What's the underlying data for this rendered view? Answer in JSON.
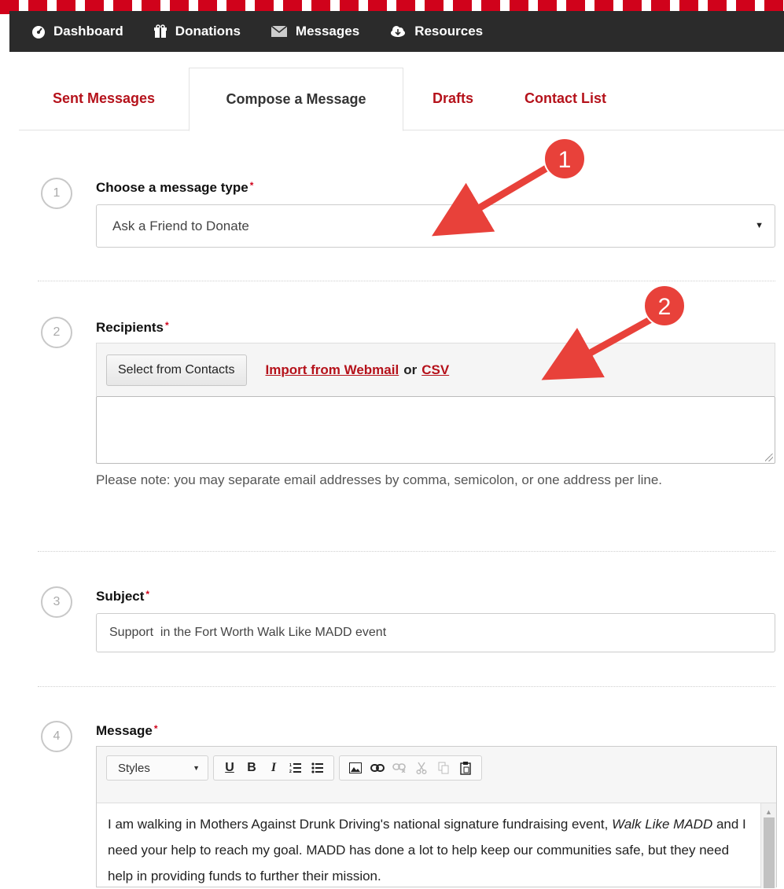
{
  "nav": {
    "items": [
      {
        "label": "Dashboard",
        "icon": "dashboard-icon"
      },
      {
        "label": "Donations",
        "icon": "gift-icon"
      },
      {
        "label": "Messages",
        "icon": "envelope-icon"
      },
      {
        "label": "Resources",
        "icon": "cloud-download-icon"
      }
    ]
  },
  "tabs": {
    "sent": "Sent Messages",
    "compose": "Compose a Message",
    "drafts": "Drafts",
    "contacts": "Contact List",
    "active": "Compose a Message"
  },
  "steps": {
    "type": {
      "number": "1",
      "label": "Choose a message type",
      "required": "*",
      "value": "Ask a Friend to Donate"
    },
    "recipients": {
      "number": "2",
      "label": "Recipients",
      "required": "*",
      "select_button": "Select from Contacts",
      "import_link": "Import from Webmail",
      "or_text": "or",
      "csv_link": "CSV",
      "value": "",
      "note": "Please note: you may separate email addresses by comma, semicolon, or one address per line."
    },
    "subject": {
      "number": "3",
      "label": "Subject",
      "required": "*",
      "value": "Support  in the Fort Worth Walk Like MADD event"
    },
    "message": {
      "number": "4",
      "label": "Message",
      "required": "*",
      "styles_label": "Styles",
      "body_part1": "I am walking in Mothers Against Drunk Driving's national signature fundraising event, ",
      "body_em": "Walk Like MADD",
      "body_part2": " and I need your help to reach my goal. MADD has done a lot to help keep our communities safe, but they need help in providing funds to further their mission."
    }
  },
  "callouts": [
    "1",
    "2"
  ],
  "colors": {
    "brand_red": "#b5121b",
    "nav_bg": "#2b2b2b",
    "callout_red": "#e8413a",
    "required": "#d0021b"
  }
}
